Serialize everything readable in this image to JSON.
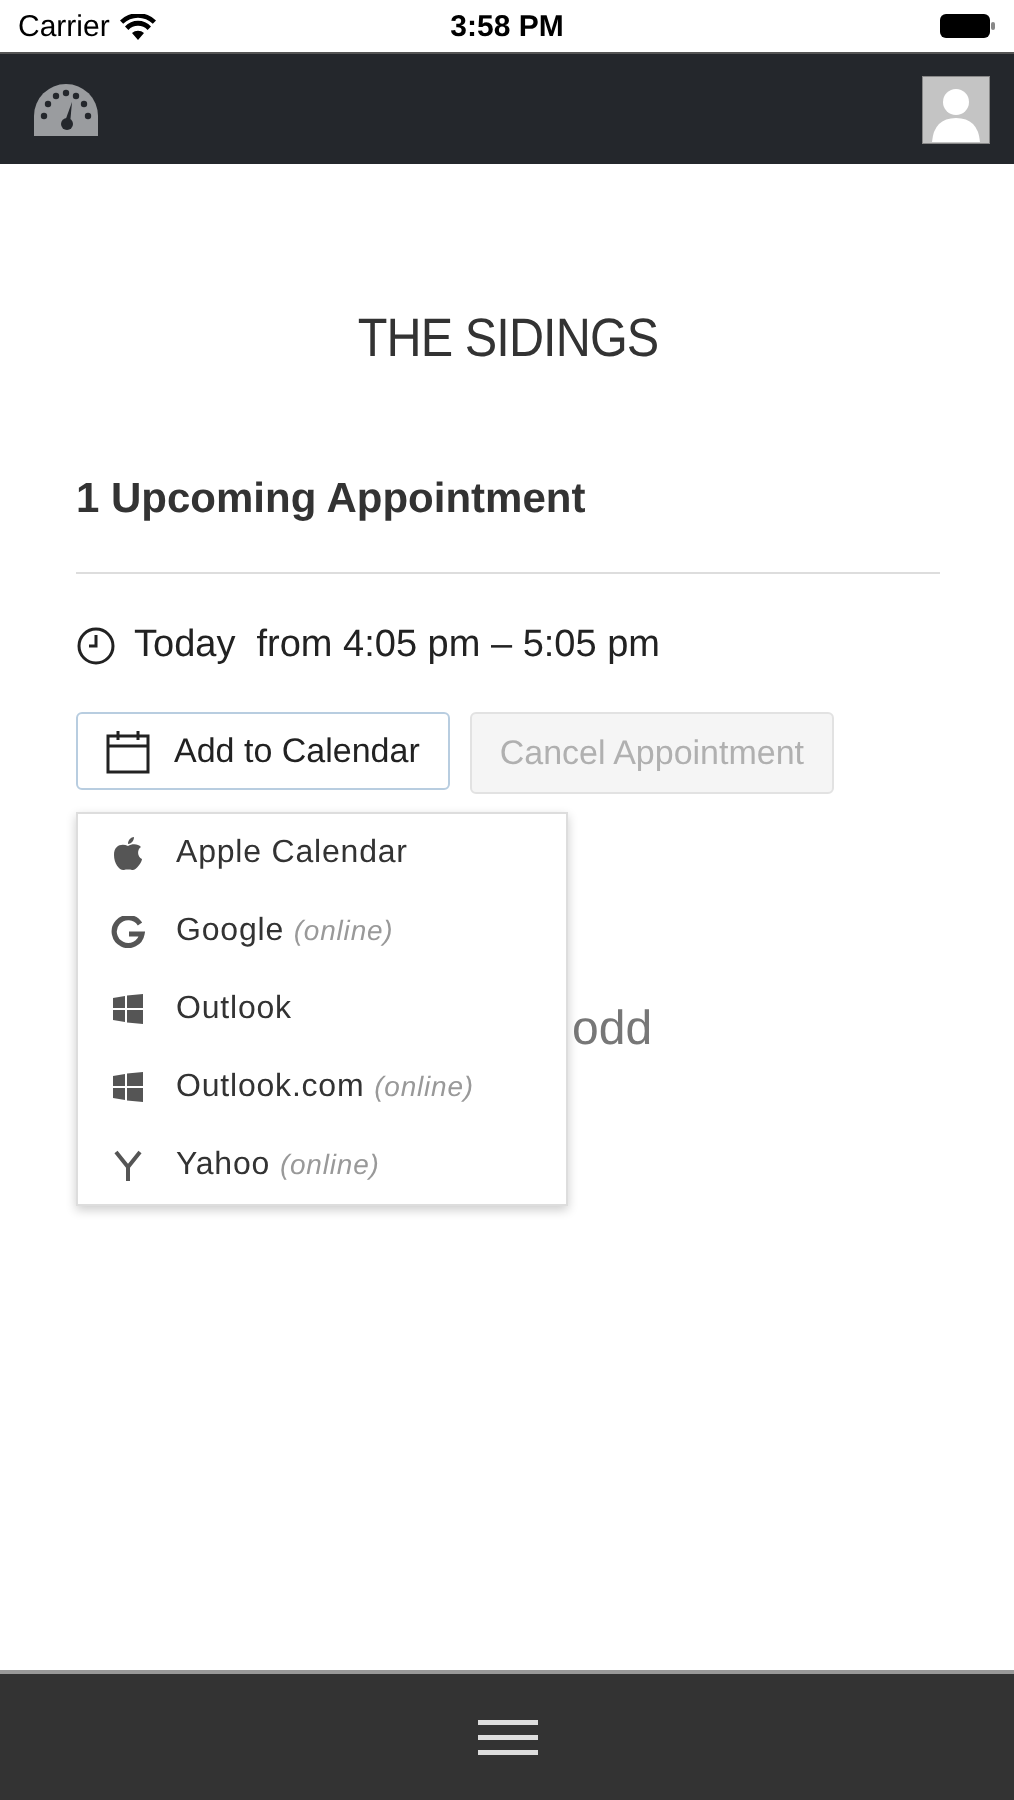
{
  "status_bar": {
    "carrier": "Carrier",
    "time": "3:58 PM"
  },
  "brand": "THE SIDINGS",
  "heading": "1 Upcoming Appointment",
  "appointment": {
    "when": "Today  from 4:05 pm – 5:05 pm"
  },
  "buttons": [
    {
      "label": "Add to Calendar",
      "kind": "calendar",
      "disabled": false
    },
    {
      "label": "Cancel Appointment",
      "kind": "plain",
      "disabled": true
    }
  ],
  "calendar_menu": [
    {
      "label": "Apple Calendar",
      "kind": "apple"
    },
    {
      "label": "Google",
      "note": "(online)",
      "kind": "google"
    },
    {
      "label": "Outlook",
      "kind": "windows"
    },
    {
      "label": "Outlook.com",
      "note": "(online)",
      "kind": "windows"
    },
    {
      "label": "Yahoo",
      "note": "(online)",
      "kind": "yahoo"
    }
  ],
  "hidden_text": [
    "odd"
  ]
}
